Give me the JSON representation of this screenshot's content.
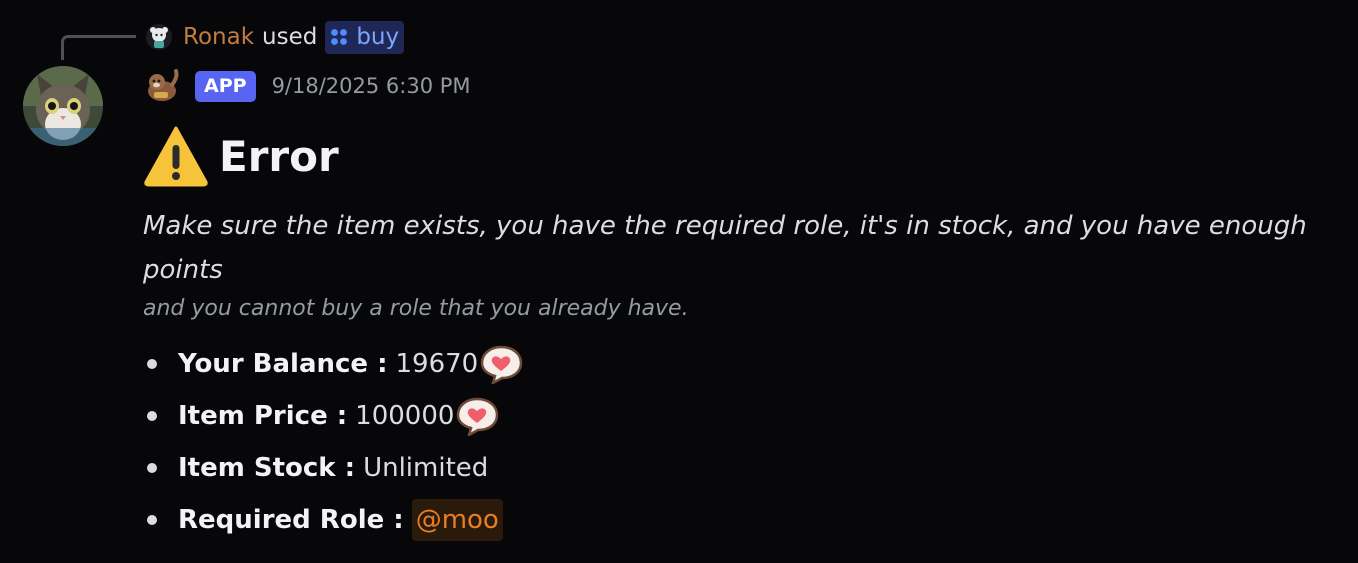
{
  "reply": {
    "user": "Ronak",
    "action": "used",
    "command": "buy"
  },
  "message": {
    "badge": "APP",
    "timestamp": "9/18/2025 6:30 PM"
  },
  "embed": {
    "title": "Error",
    "description": "Make sure the item exists, you have the required role, it's in stock, and you have enough points",
    "subtext": "and you cannot buy a role that you already have.",
    "fields": [
      {
        "label": "Your Balance :",
        "value": "19670",
        "icon": "heart-speech-icon"
      },
      {
        "label": "Item Price :",
        "value": "100000",
        "icon": "heart-speech-icon"
      },
      {
        "label": "Item Stock :",
        "value": "Unlimited"
      },
      {
        "label": "Required Role :",
        "value": "@moo"
      }
    ]
  },
  "colors": {
    "background": "#070709",
    "username": "#c27c3e",
    "command_text": "#7da4ff",
    "app_badge": "#5865f2",
    "role_mention": "#e67e22"
  }
}
